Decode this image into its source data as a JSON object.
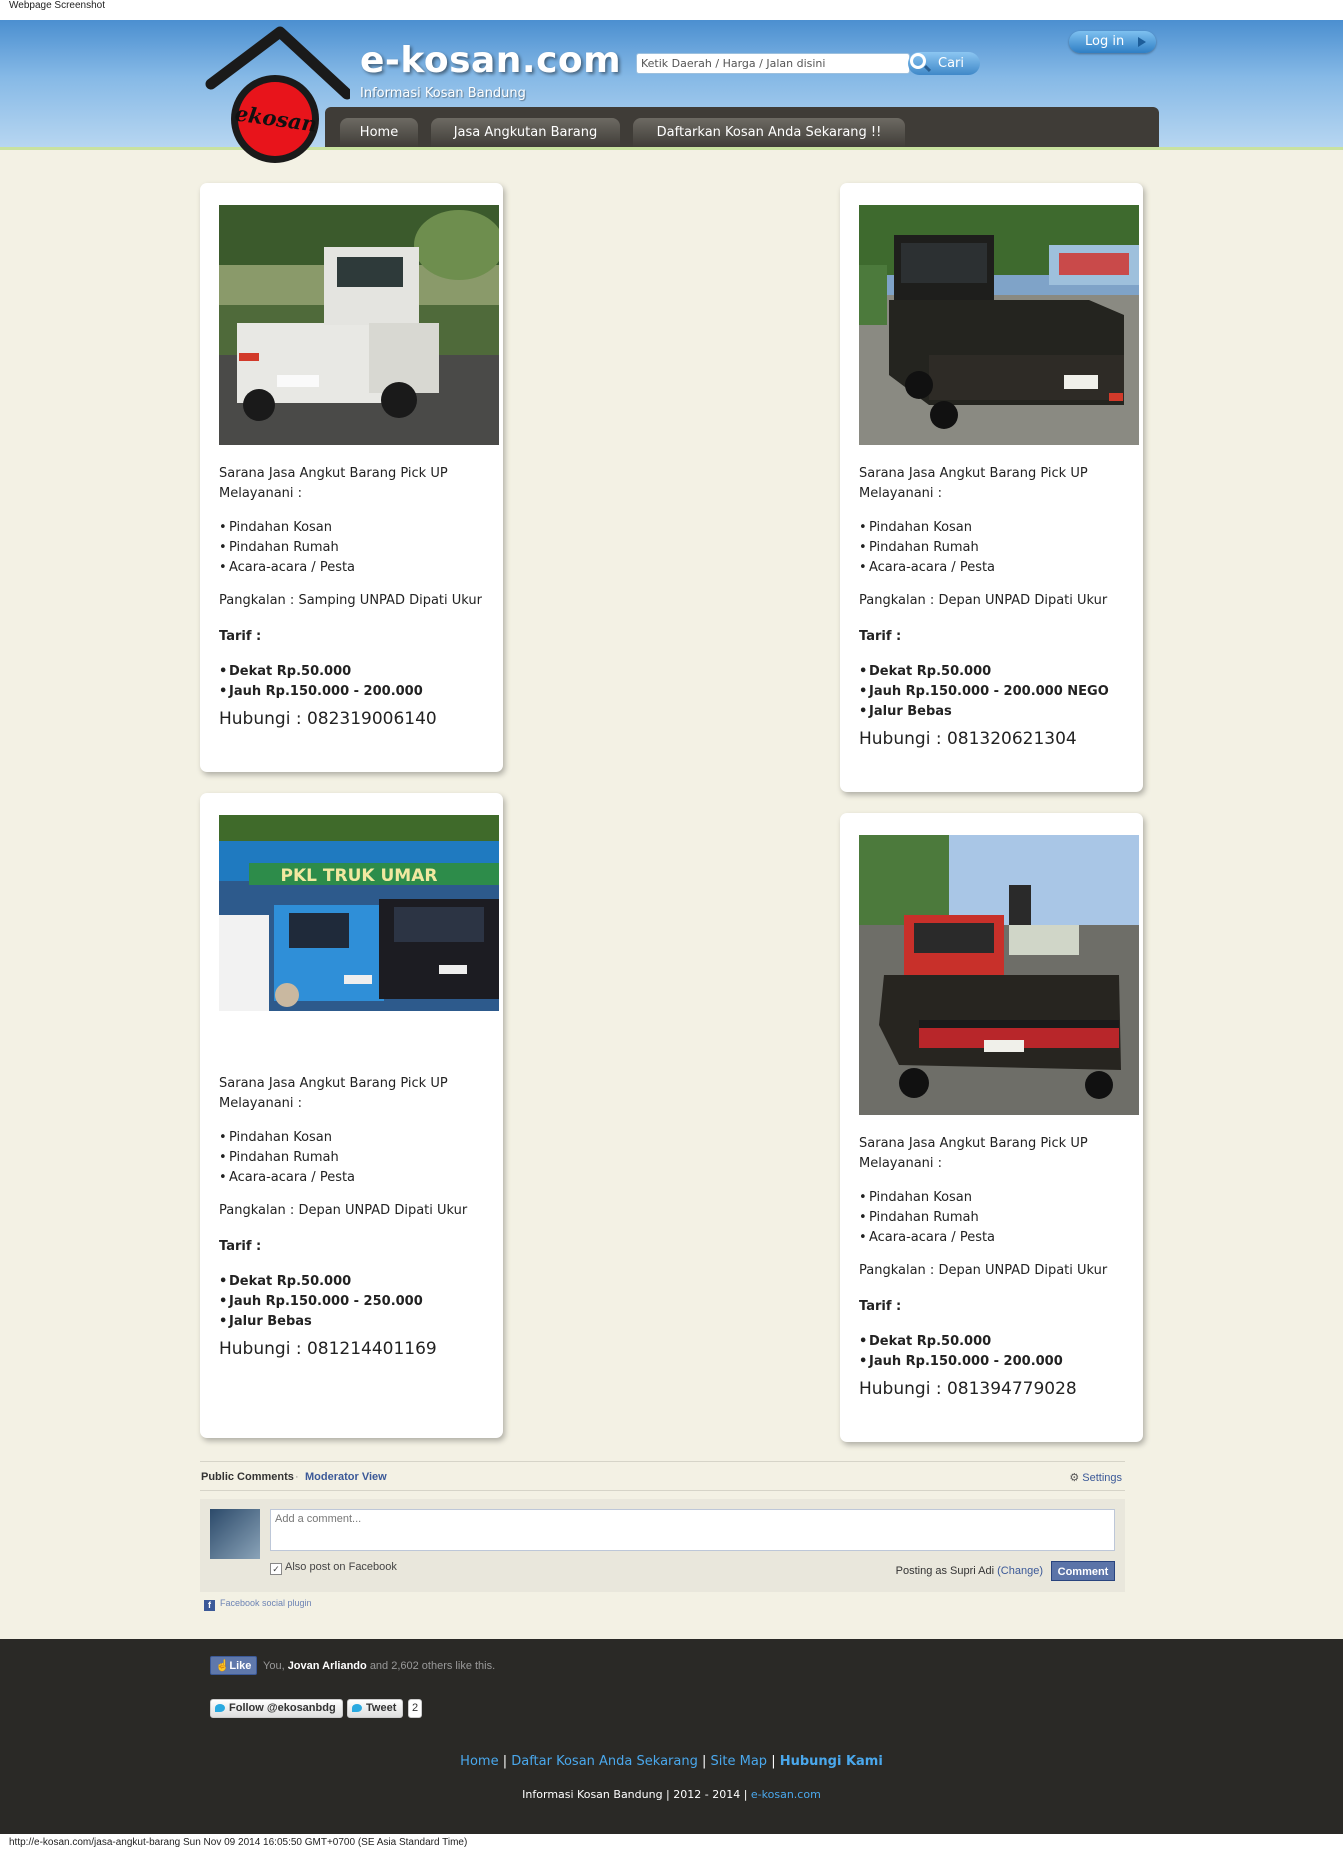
{
  "capture": {
    "label": "Webpage Screenshot",
    "status_url": "http://e-kosan.com/jasa-angkut-barang Sun Nov 09 2014 16:05:50 GMT+0700 (SE Asia Standard Time)"
  },
  "header": {
    "logo_text": "ekosan",
    "site_title": "e-kosan.com",
    "tagline": "Informasi Kosan Bandung",
    "search_placeholder": "Ketik Daerah / Harga / Jalan disini",
    "search_button": "Cari",
    "login_button": "Log in"
  },
  "nav": {
    "items": [
      {
        "label": "Home"
      },
      {
        "label": "Jasa Angkutan Barang"
      },
      {
        "label": "Daftarkan Kosan Anda Sekarang !!"
      }
    ]
  },
  "common": {
    "description": "Sarana Jasa Angkut Barang Pick UP Melayanani :",
    "services": [
      "Pindahan Kosan",
      "Pindahan Rumah",
      "Acara-acara / Pesta"
    ],
    "tarif_label": "Tarif :"
  },
  "cards": [
    {
      "photo": "white-pickup-truck-photo",
      "pangkalan": "Pangkalan : Samping UNPAD Dipati Ukur",
      "tarif": [
        "Dekat Rp.50.000",
        "Jauh Rp.150.000 - 200.000"
      ],
      "hubungi": "Hubungi : 082319006140"
    },
    {
      "photo": "black-pickup-truck-photo",
      "pangkalan": "Pangkalan : Depan UNPAD Dipati Ukur",
      "tarif": [
        "Dekat Rp.50.000",
        "Jauh Rp.150.000 - 200.000 NEGO",
        "Jalur Bebas"
      ],
      "hubungi": "Hubungi : 081320621304"
    },
    {
      "photo": "blue-and-black-pickups-photo",
      "banner_text": "PKL TRUK UMAR",
      "pangkalan": "Pangkalan : Depan UNPAD Dipati Ukur",
      "tarif": [
        "Dekat Rp.50.000",
        "Jauh Rp.150.000 - 250.000",
        "Jalur Bebas"
      ],
      "hubungi": "Hubungi : 081214401169"
    },
    {
      "photo": "red-black-suzuki-pickup-photo",
      "pangkalan": "Pangkalan : Depan UNPAD Dipati Ukur",
      "tarif": [
        "Dekat Rp.50.000",
        "Jauh Rp.150.000 - 200.000"
      ],
      "hubungi": "Hubungi : 081394779028"
    }
  ],
  "comments": {
    "public_tab": "Public Comments",
    "separator": "·",
    "moderator_tab": "Moderator View",
    "settings": "Settings",
    "placeholder": "Add a comment...",
    "also_post": "Also post on Facebook",
    "posting_as": "Posting as Supri Adi",
    "change": "(Change)",
    "comment_button": "Comment",
    "plugin_label": "Facebook social plugin"
  },
  "social": {
    "like_button": "Like",
    "like_prefix": "You,",
    "like_name": "Jovan Arliando",
    "like_suffix": "and 2,602 others like this.",
    "follow_button": "Follow @ekosanbdg",
    "tweet_button": "Tweet",
    "tweet_count": "2"
  },
  "footer": {
    "links": [
      {
        "label": "Home"
      },
      {
        "label": "Daftar Kosan Anda Sekarang"
      },
      {
        "label": "Site Map"
      },
      {
        "label": "Hubungi Kami"
      }
    ],
    "separator": "|",
    "copyright_text": "Informasi Kosan Bandung | 2012 - 2014 |",
    "copyright_link": "e-kosan.com"
  },
  "colors": {
    "header_blue": "#4b8fd0",
    "page_background": "#f3f1e4",
    "nav_dark": "#3f3c37",
    "footer_dark": "#2a2926",
    "link_blue": "#4aa8ec",
    "facebook_blue": "#3b5998",
    "logo_red": "#e8141b"
  }
}
